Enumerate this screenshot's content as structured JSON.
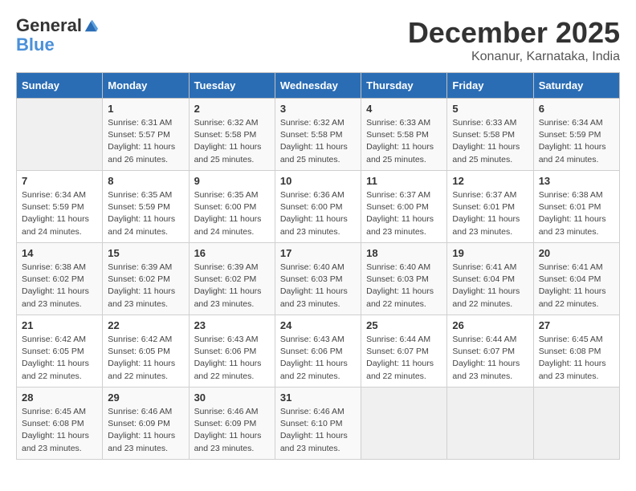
{
  "logo": {
    "line1": "General",
    "line2": "Blue"
  },
  "title": "December 2025",
  "location": "Konanur, Karnataka, India",
  "days_of_week": [
    "Sunday",
    "Monday",
    "Tuesday",
    "Wednesday",
    "Thursday",
    "Friday",
    "Saturday"
  ],
  "weeks": [
    [
      {
        "day": "",
        "info": ""
      },
      {
        "day": "1",
        "info": "Sunrise: 6:31 AM\nSunset: 5:57 PM\nDaylight: 11 hours\nand 26 minutes."
      },
      {
        "day": "2",
        "info": "Sunrise: 6:32 AM\nSunset: 5:58 PM\nDaylight: 11 hours\nand 25 minutes."
      },
      {
        "day": "3",
        "info": "Sunrise: 6:32 AM\nSunset: 5:58 PM\nDaylight: 11 hours\nand 25 minutes."
      },
      {
        "day": "4",
        "info": "Sunrise: 6:33 AM\nSunset: 5:58 PM\nDaylight: 11 hours\nand 25 minutes."
      },
      {
        "day": "5",
        "info": "Sunrise: 6:33 AM\nSunset: 5:58 PM\nDaylight: 11 hours\nand 25 minutes."
      },
      {
        "day": "6",
        "info": "Sunrise: 6:34 AM\nSunset: 5:59 PM\nDaylight: 11 hours\nand 24 minutes."
      }
    ],
    [
      {
        "day": "7",
        "info": "Sunrise: 6:34 AM\nSunset: 5:59 PM\nDaylight: 11 hours\nand 24 minutes."
      },
      {
        "day": "8",
        "info": "Sunrise: 6:35 AM\nSunset: 5:59 PM\nDaylight: 11 hours\nand 24 minutes."
      },
      {
        "day": "9",
        "info": "Sunrise: 6:35 AM\nSunset: 6:00 PM\nDaylight: 11 hours\nand 24 minutes."
      },
      {
        "day": "10",
        "info": "Sunrise: 6:36 AM\nSunset: 6:00 PM\nDaylight: 11 hours\nand 23 minutes."
      },
      {
        "day": "11",
        "info": "Sunrise: 6:37 AM\nSunset: 6:00 PM\nDaylight: 11 hours\nand 23 minutes."
      },
      {
        "day": "12",
        "info": "Sunrise: 6:37 AM\nSunset: 6:01 PM\nDaylight: 11 hours\nand 23 minutes."
      },
      {
        "day": "13",
        "info": "Sunrise: 6:38 AM\nSunset: 6:01 PM\nDaylight: 11 hours\nand 23 minutes."
      }
    ],
    [
      {
        "day": "14",
        "info": "Sunrise: 6:38 AM\nSunset: 6:02 PM\nDaylight: 11 hours\nand 23 minutes."
      },
      {
        "day": "15",
        "info": "Sunrise: 6:39 AM\nSunset: 6:02 PM\nDaylight: 11 hours\nand 23 minutes."
      },
      {
        "day": "16",
        "info": "Sunrise: 6:39 AM\nSunset: 6:02 PM\nDaylight: 11 hours\nand 23 minutes."
      },
      {
        "day": "17",
        "info": "Sunrise: 6:40 AM\nSunset: 6:03 PM\nDaylight: 11 hours\nand 23 minutes."
      },
      {
        "day": "18",
        "info": "Sunrise: 6:40 AM\nSunset: 6:03 PM\nDaylight: 11 hours\nand 22 minutes."
      },
      {
        "day": "19",
        "info": "Sunrise: 6:41 AM\nSunset: 6:04 PM\nDaylight: 11 hours\nand 22 minutes."
      },
      {
        "day": "20",
        "info": "Sunrise: 6:41 AM\nSunset: 6:04 PM\nDaylight: 11 hours\nand 22 minutes."
      }
    ],
    [
      {
        "day": "21",
        "info": "Sunrise: 6:42 AM\nSunset: 6:05 PM\nDaylight: 11 hours\nand 22 minutes."
      },
      {
        "day": "22",
        "info": "Sunrise: 6:42 AM\nSunset: 6:05 PM\nDaylight: 11 hours\nand 22 minutes."
      },
      {
        "day": "23",
        "info": "Sunrise: 6:43 AM\nSunset: 6:06 PM\nDaylight: 11 hours\nand 22 minutes."
      },
      {
        "day": "24",
        "info": "Sunrise: 6:43 AM\nSunset: 6:06 PM\nDaylight: 11 hours\nand 22 minutes."
      },
      {
        "day": "25",
        "info": "Sunrise: 6:44 AM\nSunset: 6:07 PM\nDaylight: 11 hours\nand 22 minutes."
      },
      {
        "day": "26",
        "info": "Sunrise: 6:44 AM\nSunset: 6:07 PM\nDaylight: 11 hours\nand 23 minutes."
      },
      {
        "day": "27",
        "info": "Sunrise: 6:45 AM\nSunset: 6:08 PM\nDaylight: 11 hours\nand 23 minutes."
      }
    ],
    [
      {
        "day": "28",
        "info": "Sunrise: 6:45 AM\nSunset: 6:08 PM\nDaylight: 11 hours\nand 23 minutes."
      },
      {
        "day": "29",
        "info": "Sunrise: 6:46 AM\nSunset: 6:09 PM\nDaylight: 11 hours\nand 23 minutes."
      },
      {
        "day": "30",
        "info": "Sunrise: 6:46 AM\nSunset: 6:09 PM\nDaylight: 11 hours\nand 23 minutes."
      },
      {
        "day": "31",
        "info": "Sunrise: 6:46 AM\nSunset: 6:10 PM\nDaylight: 11 hours\nand 23 minutes."
      },
      {
        "day": "",
        "info": ""
      },
      {
        "day": "",
        "info": ""
      },
      {
        "day": "",
        "info": ""
      }
    ]
  ]
}
